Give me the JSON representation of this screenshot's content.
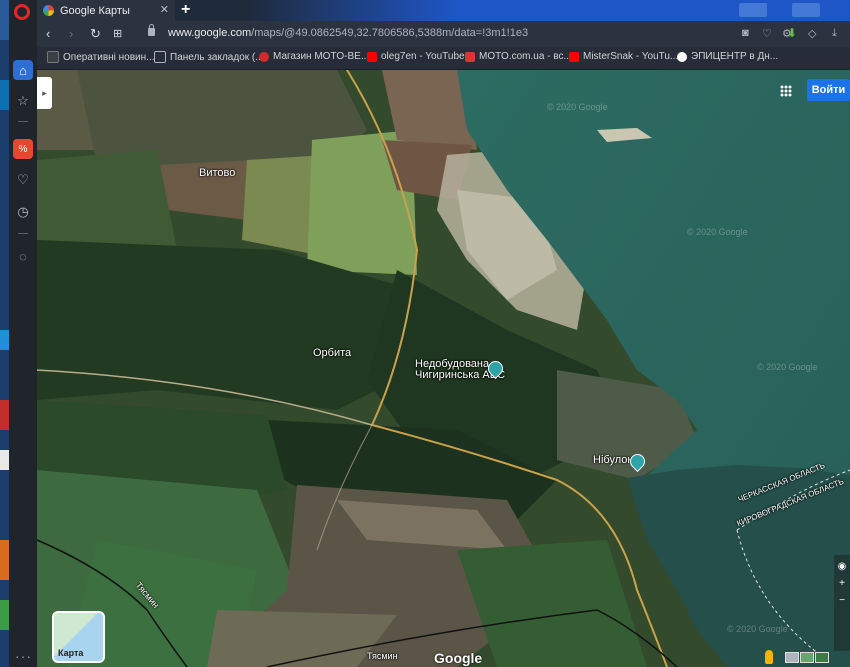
{
  "browser": {
    "tab_title": "Google Карты",
    "tab_close": "✕",
    "new_tab": "+",
    "url_domain": "www.google.com",
    "url_path": "/maps/@49.0862549,32.7806586,5388m/data=!3m1!1e3"
  },
  "bookmarks": [
    {
      "label": "Оперативні новин...",
      "icon": "news-icon",
      "color": "#3a3f48"
    },
    {
      "label": "Панель закладок (...",
      "icon": "folder-icon",
      "color": "#6b7280"
    },
    {
      "label": "Магазин MOTO-BE...",
      "icon": "moto-icon",
      "color": "#d42a2a"
    },
    {
      "label": "oleg7en - YouTube",
      "icon": "youtube-icon",
      "color": "#ff0000"
    },
    {
      "label": "MOTO.com.ua - вс...",
      "icon": "moto-com-icon",
      "color": "#d93535"
    },
    {
      "label": "MisterSnak - YouTu...",
      "icon": "youtube-icon",
      "color": "#ff0000"
    },
    {
      "label": "ЭПИЦЕНТР в Дн...",
      "icon": "epicenter-icon",
      "color": "#ffffff"
    }
  ],
  "map": {
    "signin_label": "Войти",
    "layer_label": "Карта",
    "google_logo": "Google",
    "watermark": "© 2020 Google",
    "labels": {
      "vytovo": "Витово",
      "orbita": "Орбита",
      "npp_line1": "Недобудована",
      "npp_line2": "Чигиринська АЕС",
      "nibulon": "Нібулон",
      "cherkasy_oblast": "ЧЕРКАССКАЯ ОБЛАСТЬ",
      "kirovohrad_oblast": "КИРОВОГРАДСКАЯ ОБЛАСТЬ",
      "tyasmin_1": "Тясмин",
      "tyasmin_2": "Тясмин"
    }
  },
  "colors": {
    "accent": "#1a73e8",
    "water": "#2f6b63",
    "pin": "#2fa4a8"
  }
}
